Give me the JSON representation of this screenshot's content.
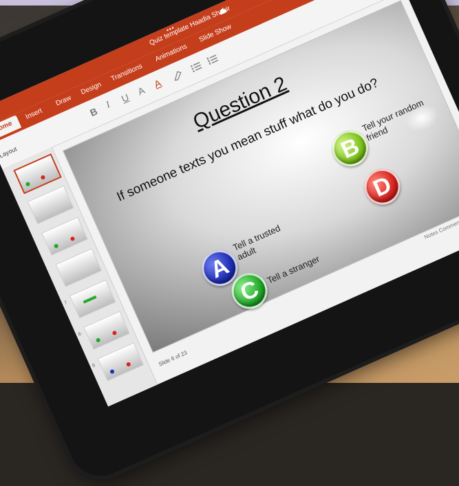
{
  "app": {
    "doc_title": "Quiz template Haadia Shakir",
    "more_dots": "•••",
    "colors": {
      "brand": "#c43e1c",
      "slide_bg": "#d9d9d9"
    }
  },
  "tabs": [
    {
      "label": "Home",
      "active": true
    },
    {
      "label": "Insert"
    },
    {
      "label": "Draw"
    },
    {
      "label": "Design"
    },
    {
      "label": "Transitions"
    },
    {
      "label": "Animations"
    },
    {
      "label": "Slide Show"
    }
  ],
  "ribbon": {
    "layout_label": "Layout",
    "bold": "B",
    "italic": "I",
    "underline": "U",
    "font_size_up": "A",
    "font_color": "A"
  },
  "thumbnails": {
    "numbers": [
      "",
      "",
      "",
      "",
      "7",
      "8",
      "9"
    ]
  },
  "slide": {
    "title": "Question 2",
    "question": "If someone texts you mean stuff what do you do?",
    "options": [
      {
        "letter": "A",
        "label": "Tell a trusted adult",
        "color": "#1f2fb5"
      },
      {
        "letter": "B",
        "label": "Tell your random friend",
        "color": "#7bc31c"
      },
      {
        "letter": "C",
        "label": "Tell a stranger",
        "color": "#22a82a"
      },
      {
        "letter": "D",
        "label": "",
        "color": "#d8241f"
      }
    ]
  },
  "status": {
    "slide_counter": "Slide 6 of 23",
    "right": "Notes   Comments"
  }
}
